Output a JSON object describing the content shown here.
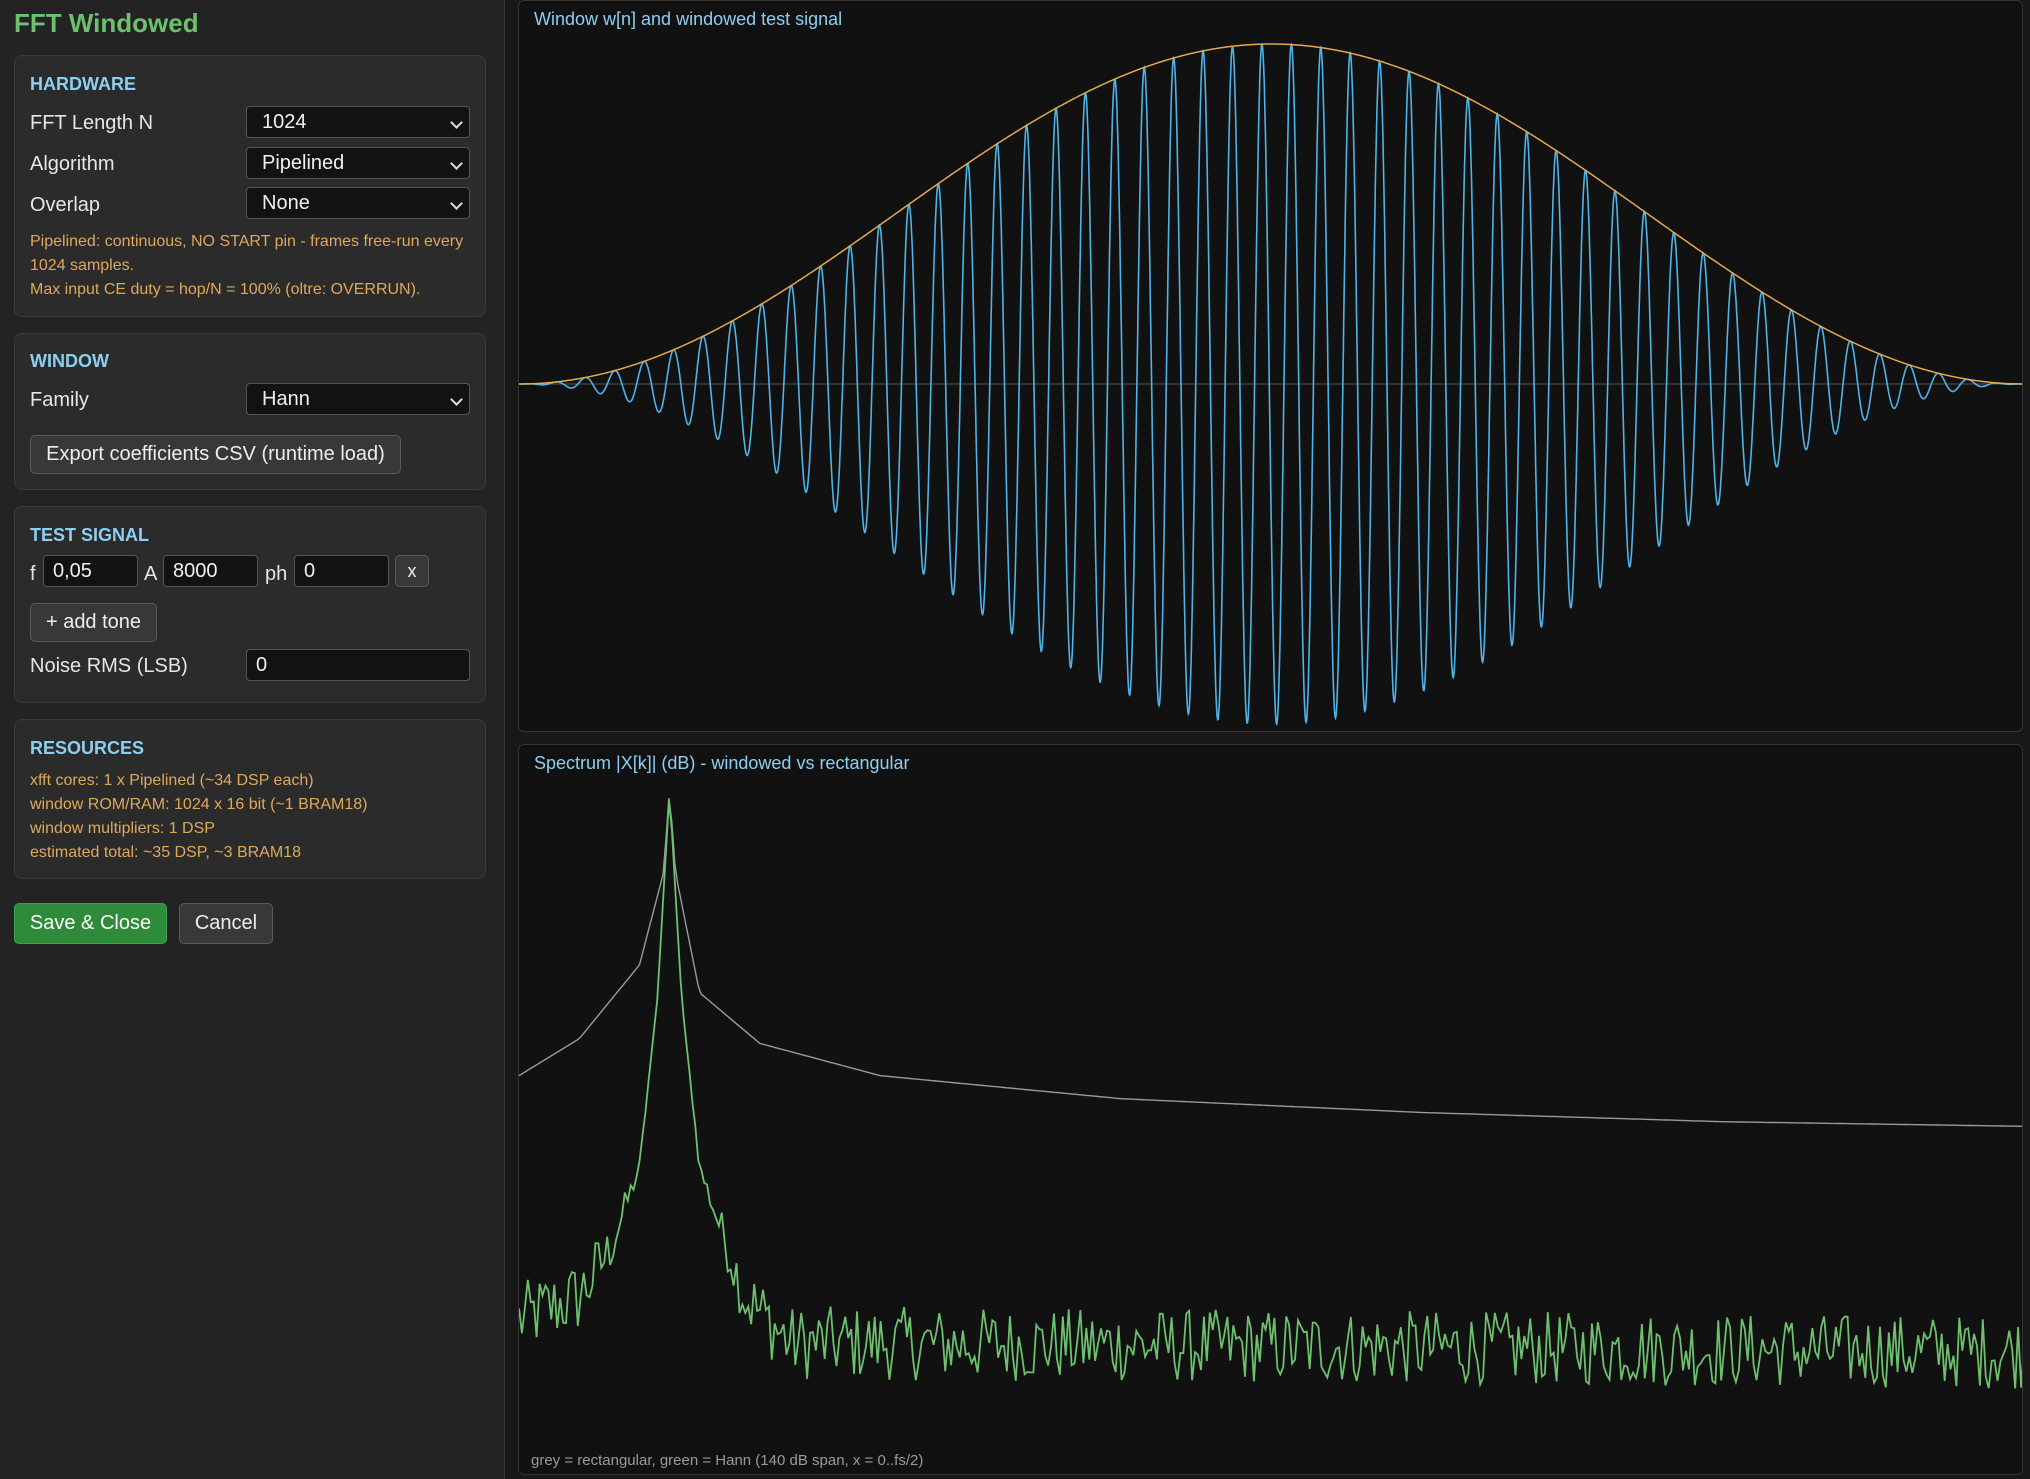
{
  "app": {
    "title": "FFT Windowed"
  },
  "hardware": {
    "heading": "HARDWARE",
    "fft_length_label": "FFT Length N",
    "fft_length_value": "1024",
    "algorithm_label": "Algorithm",
    "algorithm_value": "Pipelined",
    "overlap_label": "Overlap",
    "overlap_value": "None",
    "note_line1": "Pipelined: continuous, NO START pin - frames free-run every",
    "note_line2": "1024 samples.",
    "note_line3": "Max input CE duty = hop/N = 100% (oltre: OVERRUN)."
  },
  "window": {
    "heading": "WINDOW",
    "family_label": "Family",
    "family_value": "Hann",
    "export_label": "Export coefficients CSV (runtime load)"
  },
  "test_signal": {
    "heading": "TEST SIGNAL",
    "tones": [
      {
        "f_label": "f",
        "f": "0,05",
        "a_label": "A",
        "a": "8000",
        "ph_label": "ph",
        "ph": "0",
        "remove_label": "x"
      }
    ],
    "add_tone_label": "+ add tone",
    "noise_label": "Noise RMS (LSB)",
    "noise_value": "0"
  },
  "resources": {
    "heading": "RESOURCES",
    "lines": [
      "xfft cores: 1 x Pipelined (~34 DSP each)",
      "window ROM/RAM: 1024 x 16 bit (~1 BRAM18)",
      "window multipliers: 1 DSP",
      "estimated total: ~35 DSP, ~3 BRAM18"
    ]
  },
  "actions": {
    "save_label": "Save & Close",
    "cancel_label": "Cancel"
  },
  "colors": {
    "accent_green": "#6cc06e",
    "heading_blue": "#8dcff2",
    "note_orange": "#e0a85a",
    "signal_blue": "#4fb3e8",
    "envelope_orange": "#e3a94c",
    "rect_grey": "#9a9a9a",
    "hann_green": "#6cc06e"
  },
  "chart_data": [
    {
      "type": "line",
      "title": "Window w[n] and windowed test signal",
      "series": [
        {
          "name": "w[n]",
          "color": "#e3a94c",
          "kind": "hann",
          "x_range": [
            0,
            1023
          ],
          "y_range": [
            0,
            1
          ]
        },
        {
          "name": "windowed test signal",
          "color": "#4fb3e8",
          "kind": "sine",
          "frequency_cycles_per_sample": 0.05,
          "amplitude": 8000,
          "phase": 0
        }
      ],
      "ylim": [
        -1,
        1
      ],
      "grid": false
    },
    {
      "type": "line",
      "title": "Spectrum |X[k]| (dB) - windowed vs rectangular",
      "caption": "grey = rectangular, green = Hann  (140 dB span, x = 0..fs/2)",
      "ylim": [
        -140,
        0
      ],
      "x_range": [
        0,
        0.5
      ],
      "peak_x": 0.05,
      "series": [
        {
          "name": "rectangular",
          "color": "#9a9a9a",
          "x": [
            0,
            0.02,
            0.04,
            0.048,
            0.05,
            0.052,
            0.06,
            0.08,
            0.12,
            0.2,
            0.3,
            0.4,
            0.5
          ],
          "y": [
            -62,
            -54,
            -38,
            -18,
            0,
            -18,
            -44,
            -55,
            -62,
            -67,
            -70,
            -72,
            -73
          ]
        },
        {
          "name": "Hann",
          "color": "#6cc06e",
          "x": [
            0,
            0.02,
            0.03,
            0.04,
            0.046,
            0.05,
            0.054,
            0.06,
            0.075,
            0.09,
            0.5
          ],
          "y": [
            -115,
            -110,
            -100,
            -82,
            -45,
            0,
            -45,
            -82,
            -110,
            -120,
            -122
          ]
        }
      ]
    }
  ]
}
